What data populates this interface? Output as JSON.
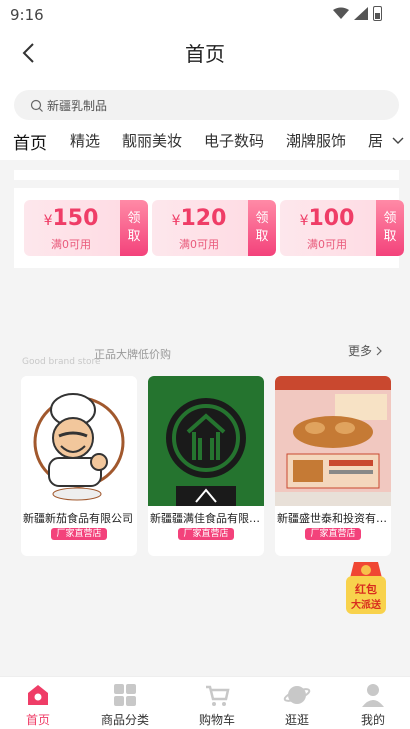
{
  "status_bar": {
    "time": "9:16"
  },
  "header": {
    "title": "首页"
  },
  "search": {
    "placeholder": "新疆乳制品"
  },
  "tabs": [
    {
      "label": "首页"
    },
    {
      "label": "精选"
    },
    {
      "label": "靓丽美妆"
    },
    {
      "label": "电子数码"
    },
    {
      "label": "潮牌服饰"
    },
    {
      "label": "居"
    }
  ],
  "coupons": [
    {
      "currency": "¥",
      "amount": "150",
      "condition": "满0可用",
      "action": "领取"
    },
    {
      "currency": "¥",
      "amount": "120",
      "condition": "满0可用",
      "action": "领取"
    },
    {
      "currency": "¥",
      "amount": "100",
      "condition": "满0可用",
      "action": "领取"
    }
  ],
  "brands": {
    "title": "正品大牌低价购",
    "subtitle": "Good brand store",
    "more": "更多",
    "items": [
      {
        "name": "新疆新茄食品有限公司",
        "badge": "厂家直营店"
      },
      {
        "name": "新疆疆满佳食品有限公司",
        "badge": "厂家直营店"
      },
      {
        "name": "新疆盛世泰和投资有限公司",
        "badge": "厂家直营店"
      }
    ]
  },
  "red_packet": {
    "line1": "红包",
    "line2": "大派送"
  },
  "tabbar": [
    {
      "label": "首页",
      "icon": "home-icon",
      "active": true
    },
    {
      "label": "商品分类",
      "icon": "category-icon"
    },
    {
      "label": "购物车",
      "icon": "cart-icon"
    },
    {
      "label": "逛逛",
      "icon": "planet-icon"
    },
    {
      "label": "我的",
      "icon": "user-icon"
    }
  ],
  "colors": {
    "accent": "#ef3d67",
    "coupon_bg": "#fde7ec"
  }
}
